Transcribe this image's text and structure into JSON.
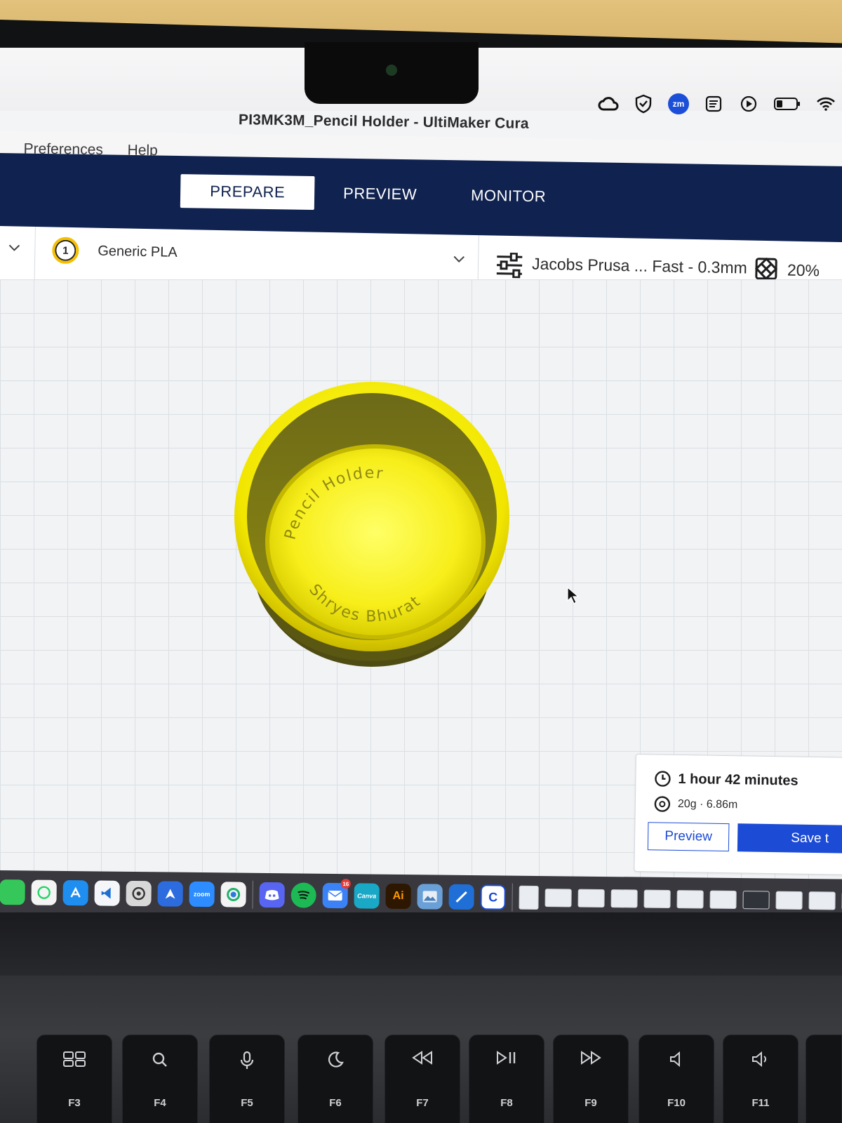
{
  "window": {
    "title": "PI3MK3M_Pencil Holder - UltiMaker Cura"
  },
  "menus": [
    "Preferences",
    "Help"
  ],
  "stages": [
    {
      "label": "PREPARE",
      "active": true
    },
    {
      "label": "PREVIEW",
      "active": false
    },
    {
      "label": "MONITOR",
      "active": false
    }
  ],
  "extruder": {
    "number": "1",
    "material": "Generic PLA"
  },
  "print_profile": {
    "name": "Jacobs Prusa ... Fast - 0.3mm",
    "infill": "20%"
  },
  "model": {
    "engraving_top": "Pencil Holder",
    "engraving_bottom": "Shryes Bhurat",
    "color": "#ffff00"
  },
  "print_summary": {
    "time": "1 hour 42 minutes",
    "material_usage": "20g · 6.86m",
    "preview_button": "Preview",
    "save_button": "Save t"
  },
  "menubar_icons": [
    "creative-cloud-icon",
    "shield-icon",
    "zoom-icon",
    "notes-icon",
    "play-icon",
    "battery-icon",
    "wifi-icon"
  ],
  "menubar_zoom_label": "zm",
  "dock": {
    "apps": [
      {
        "name": "messages-icon",
        "label": "",
        "color": "#35c759"
      },
      {
        "name": "whatsapp-icon",
        "label": "",
        "color": "#25d366"
      },
      {
        "name": "app-store-icon",
        "label": "",
        "color": "#1f8ef1"
      },
      {
        "name": "vscode-icon",
        "label": "",
        "color": "#1e6fd0"
      },
      {
        "name": "chatgpt-icon",
        "label": "",
        "color": "#444"
      },
      {
        "name": "arc-icon",
        "label": "",
        "color": "#2d6cdf"
      },
      {
        "name": "zoom-icon",
        "label": "zoom",
        "color": "#2d8cff"
      },
      {
        "name": "edge-icon",
        "label": "",
        "color": "#1fb16b"
      },
      {
        "name": "discord-icon",
        "label": "",
        "color": "#5865f2"
      },
      {
        "name": "spotify-icon",
        "label": "",
        "color": "#1db954"
      },
      {
        "name": "mail-icon",
        "label": "",
        "color": "#3b82f6",
        "badge": "16"
      },
      {
        "name": "canva-icon",
        "label": "Canva",
        "color": "#19a8c6"
      },
      {
        "name": "illustrator-icon",
        "label": "Ai",
        "color": "#2e1700"
      },
      {
        "name": "preview-app-icon",
        "label": "",
        "color": "#6aa0d8"
      },
      {
        "name": "xcode-icon",
        "label": "",
        "color": "#1f6fd6"
      },
      {
        "name": "cura-icon",
        "label": "C",
        "color": "#1c4bd6"
      }
    ]
  },
  "keyboard": {
    "keys": [
      "F3",
      "F4",
      "F5",
      "F6",
      "F7",
      "F8",
      "F9",
      "F10",
      "F11"
    ]
  }
}
